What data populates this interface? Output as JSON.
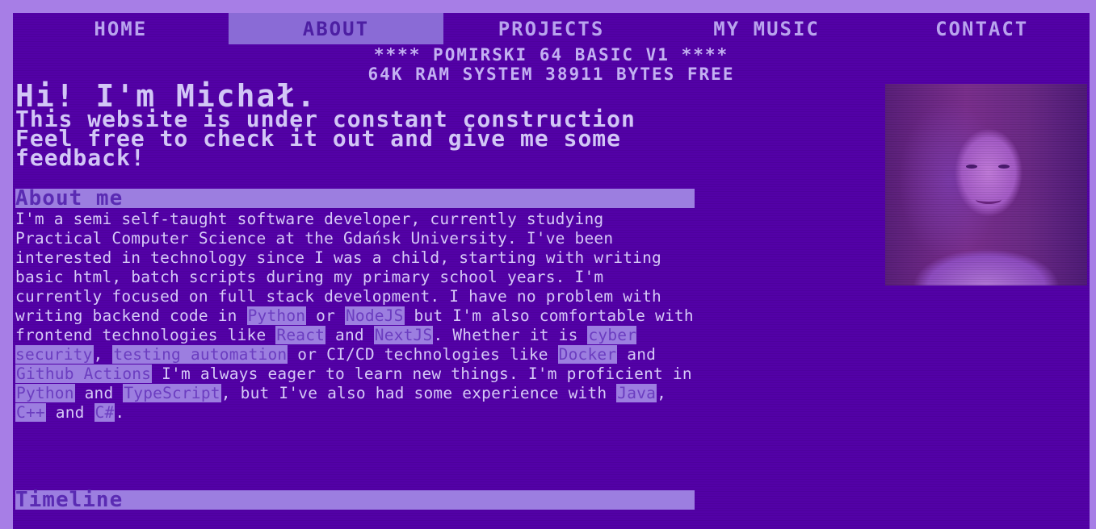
{
  "nav": {
    "items": [
      {
        "label": "HOME"
      },
      {
        "label": "ABOUT"
      },
      {
        "label": "PROJECTS"
      },
      {
        "label": "MY MUSIC"
      },
      {
        "label": "CONTACT"
      }
    ],
    "active": "ABOUT"
  },
  "banner": {
    "line1": "**** POMIRSKI 64 BASIC V1 ****",
    "line2": "64K RAM SYSTEM 38911 BYTES FREE"
  },
  "hero": {
    "greeting": "Hi! I'm Michał.",
    "intro": "This website is under constant construction Feel free to check it out and give me some feedback!"
  },
  "about": {
    "title": "About me",
    "p1": "I'm a semi self-taught software developer, currently studying Practical Computer Science at the Gdańsk University. I've been interested in technology since I was a child, starting with writing basic html, batch scripts during my primary school years. I'm currently focused on full stack development. I have no problem with writing backend code in ",
    "python1": "Python",
    "t_or1": " or ",
    "nodejs": "NodeJS",
    "t_but": " but I'm also comfortable with frontend technologies like ",
    "react": "React",
    "t_and1": " and ",
    "nextjs": "NextJS",
    "t_whether": ". Whether it is ",
    "cyber": "cyber security",
    "t_comma1": ", ",
    "testing": "testing automation",
    "t_or2": " or CI/CD technologies like ",
    "docker": "Docker",
    "t_and2": " and ",
    "gha": "Github Actions",
    "t_eager": " I'm always eager to learn new things. I'm proficient in ",
    "python2": "Python",
    "t_and3": " and ",
    "typescript": "TypeScript",
    "t_but2": ", but I've also had some experience with ",
    "java": "Java",
    "t_comma2": ", ",
    "cpp": "C++",
    "t_and4": " and ",
    "csharp": "C#",
    "t_end": "."
  },
  "timeline": {
    "title": "Timeline"
  },
  "colors": {
    "outer_frame": "#a77ee6",
    "screen": "#5301a7",
    "text": "#d6c9f7",
    "highlight": "#9c7ee0"
  }
}
